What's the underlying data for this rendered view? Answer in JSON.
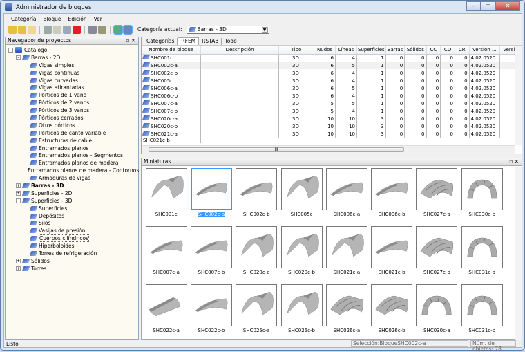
{
  "window": {
    "title": "Administrador de bloques",
    "buttons": [
      "–",
      "□",
      "✕"
    ]
  },
  "menu": [
    "Categoría",
    "Bloque",
    "Edición",
    "Ver"
  ],
  "toolbar": {
    "category_label": "Categoría actual:",
    "category_value": "Barras - 3D",
    "icons": [
      "new-folder-icon",
      "open-folder-icon",
      "folder-icon",
      "copy-icon",
      "paste-icon",
      "duplicate-icon",
      "delete-icon",
      "import-icon",
      "export-icon",
      "thumbnail-view-icon",
      "zoom-view-icon"
    ]
  },
  "navigator": {
    "title": "Navegador de proyectos",
    "controls": "▫ ✕",
    "items": [
      {
        "label": "Catálogo",
        "level": 0,
        "exp": "-",
        "bold": false
      },
      {
        "label": "Barras - 2D",
        "level": 1,
        "exp": "-"
      },
      {
        "label": "Vigas simples",
        "level": 2
      },
      {
        "label": "Vigas continuas",
        "level": 2
      },
      {
        "label": "Vigas curvadas",
        "level": 2
      },
      {
        "label": "Vigas atirantadas",
        "level": 2
      },
      {
        "label": "Pórticos de 1 vano",
        "level": 2
      },
      {
        "label": "Pórticos de 2 vanos",
        "level": 2
      },
      {
        "label": "Pórticos de 3 vanos",
        "level": 2
      },
      {
        "label": "Pórticos cerrados",
        "level": 2
      },
      {
        "label": "Otros pórticos",
        "level": 2
      },
      {
        "label": "Pórticos de canto variable",
        "level": 2
      },
      {
        "label": "Estructuras de cable",
        "level": 2
      },
      {
        "label": "Entramados planos",
        "level": 2
      },
      {
        "label": "Entramados planos - Segmentos",
        "level": 2
      },
      {
        "label": "Entramados planos de madera",
        "level": 2
      },
      {
        "label": "Entramados planos de madera - Contornos",
        "level": 2
      },
      {
        "label": "Armaduras de vigas",
        "level": 2
      },
      {
        "label": "Barras - 3D",
        "level": 1,
        "exp": "+",
        "bold": true
      },
      {
        "label": "Superficies - 2D",
        "level": 1,
        "exp": "+"
      },
      {
        "label": "Superficies - 3D",
        "level": 1,
        "exp": "-"
      },
      {
        "label": "Superficies",
        "level": 2
      },
      {
        "label": "Depósitos",
        "level": 2
      },
      {
        "label": "Silos",
        "level": 2
      },
      {
        "label": "Vasijas de presión",
        "level": 2
      },
      {
        "label": "Cuerpos cilíndricos",
        "level": 2,
        "selected": true
      },
      {
        "label": "Hiperboloides",
        "level": 2
      },
      {
        "label": "Torres de refrigeración",
        "level": 2
      },
      {
        "label": "Sólidos",
        "level": 1,
        "exp": "+"
      },
      {
        "label": "Torres",
        "level": 1,
        "exp": "+"
      }
    ]
  },
  "tabs": [
    "Categorías",
    "RFEM",
    "RSTAB",
    "Todo"
  ],
  "table": {
    "columns": [
      "Nombre de bloque",
      "Descripción",
      "Tipo",
      "Nudos",
      "Líneas",
      "Superficies",
      "Barras",
      "Sólidos",
      "CC",
      "CO",
      "CR",
      "Versión ...",
      "Versió"
    ],
    "rows": [
      [
        "SHC001c",
        "",
        "3D",
        "6",
        "4",
        "1",
        "0",
        "0",
        "0",
        "0",
        "0",
        "4.02.0520",
        ""
      ],
      [
        "SHC002c-a",
        "",
        "3D",
        "6",
        "5",
        "1",
        "0",
        "0",
        "0",
        "0",
        "0",
        "4.02.0520",
        ""
      ],
      [
        "SHC002c-b",
        "",
        "3D",
        "6",
        "4",
        "1",
        "0",
        "0",
        "0",
        "0",
        "0",
        "4.02.0520",
        ""
      ],
      [
        "SHC005c",
        "",
        "3D",
        "6",
        "4",
        "1",
        "0",
        "0",
        "0",
        "0",
        "0",
        "4.02.0520",
        ""
      ],
      [
        "SHC006c-a",
        "",
        "3D",
        "6",
        "5",
        "1",
        "0",
        "0",
        "0",
        "0",
        "0",
        "4.02.0520",
        ""
      ],
      [
        "SHC006c-b",
        "",
        "3D",
        "6",
        "4",
        "1",
        "0",
        "0",
        "0",
        "0",
        "0",
        "4.02.0520",
        ""
      ],
      [
        "SHC007c-a",
        "",
        "3D",
        "5",
        "5",
        "1",
        "0",
        "0",
        "0",
        "0",
        "0",
        "4.02.0520",
        ""
      ],
      [
        "SHC007c-b",
        "",
        "3D",
        "5",
        "4",
        "1",
        "0",
        "0",
        "0",
        "0",
        "0",
        "4.02.0520",
        ""
      ],
      [
        "SHC020c-a",
        "",
        "3D",
        "10",
        "10",
        "3",
        "0",
        "0",
        "0",
        "0",
        "0",
        "4.02.0520",
        ""
      ],
      [
        "SHC020c-b",
        "",
        "3D",
        "10",
        "10",
        "3",
        "0",
        "0",
        "0",
        "0",
        "0",
        "4.02.0520",
        ""
      ],
      [
        "SHC021c-a",
        "",
        "3D",
        "10",
        "10",
        "3",
        "0",
        "0",
        "0",
        "0",
        "0",
        "4.02.0520",
        ""
      ]
    ],
    "partial_row": "SHC021c-b",
    "scroll_mid": "III"
  },
  "thumbnails": {
    "title": "Miniaturas",
    "selected": "SHC002c-a",
    "items": [
      {
        "name": "SHC001c",
        "shape": "arch"
      },
      {
        "name": "SHC002c-a",
        "shape": "wing"
      },
      {
        "name": "SHC002c-b",
        "shape": "wing"
      },
      {
        "name": "SHC005c",
        "shape": "arch"
      },
      {
        "name": "SHC006c-a",
        "shape": "wing"
      },
      {
        "name": "SHC006c-b",
        "shape": "wing"
      },
      {
        "name": "SHC027c-a",
        "shape": "ribbed"
      },
      {
        "name": "SHC030c-b",
        "shape": "ring"
      },
      {
        "name": "SHC007c-a",
        "shape": "wing"
      },
      {
        "name": "SHC007c-b",
        "shape": "wing"
      },
      {
        "name": "SHC020c-a",
        "shape": "arch"
      },
      {
        "name": "SHC020c-b",
        "shape": "arch"
      },
      {
        "name": "SHC021c-a",
        "shape": "arch"
      },
      {
        "name": "SHC021c-b",
        "shape": "wing"
      },
      {
        "name": "SHC027c-b",
        "shape": "ribbed"
      },
      {
        "name": "SHC031c-a",
        "shape": "ring"
      },
      {
        "name": "SHC022c-a",
        "shape": "half"
      },
      {
        "name": "SHC022c-b",
        "shape": "wing"
      },
      {
        "name": "SHC025c-a",
        "shape": "arch"
      },
      {
        "name": "SHC025c-b",
        "shape": "arch"
      },
      {
        "name": "SHC026c-a",
        "shape": "ribbed"
      },
      {
        "name": "SHC026c-b",
        "shape": "ribbed"
      },
      {
        "name": "SHC030c-a",
        "shape": "ring"
      },
      {
        "name": "SHC031c-b",
        "shape": "ring"
      }
    ]
  },
  "status": {
    "left": "Listo",
    "selection": "Selección:BloqueSHC002c-a",
    "count": "Núm. de objetos: 78"
  }
}
